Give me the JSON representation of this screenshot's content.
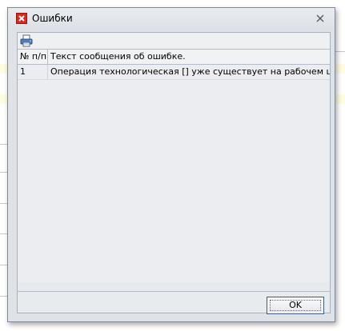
{
  "window": {
    "title": "Ошибки"
  },
  "toolbar": {
    "print_icon": "printer-icon"
  },
  "grid": {
    "columns": [
      "№ п/п",
      "Текст сообщения об ошибке."
    ],
    "rows": [
      [
        "1",
        "Операция технологическая [] уже существует на рабочем центре."
      ]
    ]
  },
  "footer": {
    "ok_label": "OK"
  },
  "colors": {
    "window_bg": "#dfe3e8",
    "error_icon": "#d8281f",
    "grid_bg": "#ebedf0",
    "bg_row_yellow": "#fffde0"
  }
}
